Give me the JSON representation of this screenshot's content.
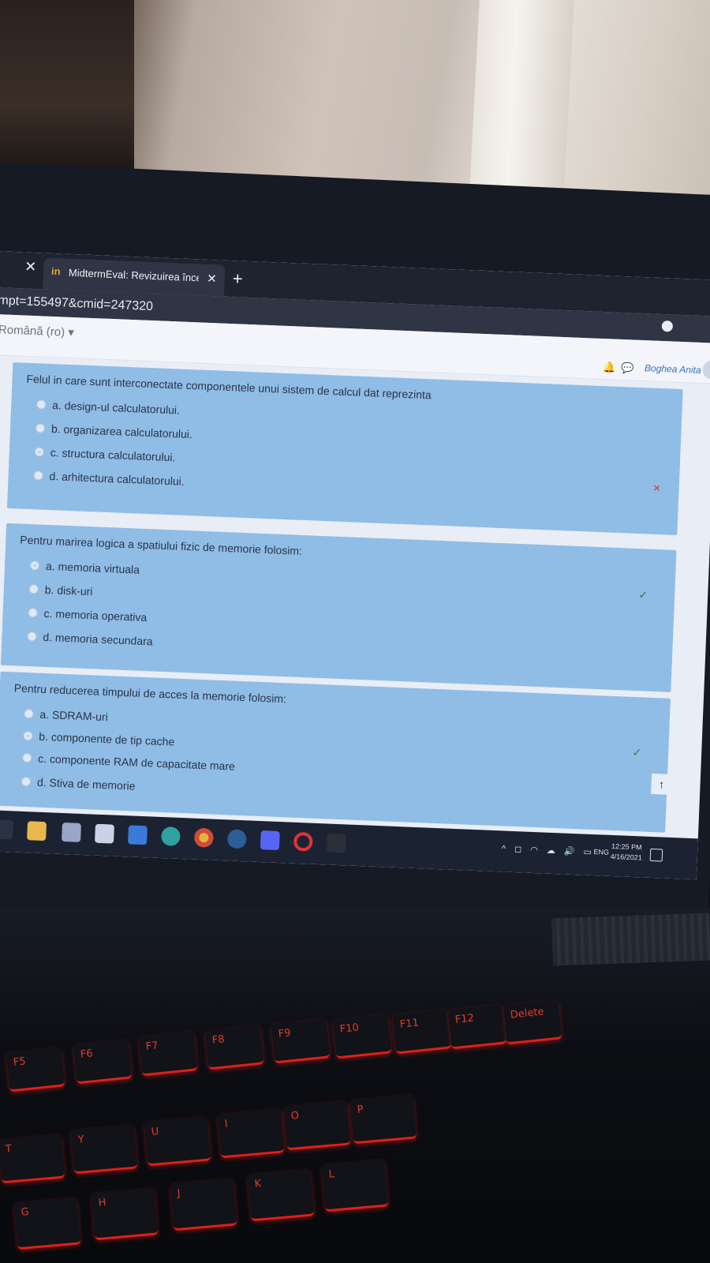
{
  "browser": {
    "tab_title": "MidtermEval: Revizuirea încercări",
    "tab_favicon": "in",
    "url": "mpt=155497&cmid=247320"
  },
  "page": {
    "language": "Română (ro)",
    "user_name": "Boghea Anita"
  },
  "questions": [
    {
      "text": "Felul in care sunt interconectate componentele unui sistem de calcul dat reprezinta",
      "options": [
        "a. design-ul calculatorului.",
        "b. organizarea calculatorului.",
        "c. structura calculatorului.",
        "d. arhitectura calculatorului."
      ],
      "selected": 2,
      "result_mark": "×"
    },
    {
      "text": "Pentru marirea logica a spatiului fizic de memorie folosim:",
      "options": [
        "a. memoria virtuala",
        "b. disk-uri",
        "c. memoria operativa",
        "d. memoria secundara"
      ],
      "selected": 0,
      "result_mark": "✓"
    },
    {
      "text": "Pentru reducerea timpului de acces la memorie folosim:",
      "options": [
        "a. SDRAM-uri",
        "b. componente de tip cache",
        "c. componente RAM de capacitate mare",
        "d. Stiva de memorie"
      ],
      "selected": 1,
      "result_mark": "✓"
    }
  ],
  "taskbar": {
    "language": "ENG",
    "time": "12:25 PM",
    "date": "4/16/2021",
    "icons": [
      "task-view-icon",
      "file-explorer-icon",
      "stack-icon",
      "store-icon",
      "mail-icon",
      "edge-icon",
      "chrome-icon",
      "steam-icon",
      "discord-icon",
      "opera-icon",
      "epic-games-icon"
    ]
  },
  "keyboard": {
    "fn_keys": [
      "F5",
      "F6",
      "F7",
      "F8",
      "F9",
      "F10",
      "F11",
      "F12",
      "Delete"
    ],
    "letters": [
      "T",
      "Y",
      "U",
      "I",
      "O",
      "P",
      "G",
      "H",
      "J",
      "K",
      "L"
    ]
  },
  "colors": {
    "card": "#8fbde6",
    "wrong": "#d64a4a",
    "correct": "#3b7a4a",
    "key_backlight": "#e0201a"
  }
}
